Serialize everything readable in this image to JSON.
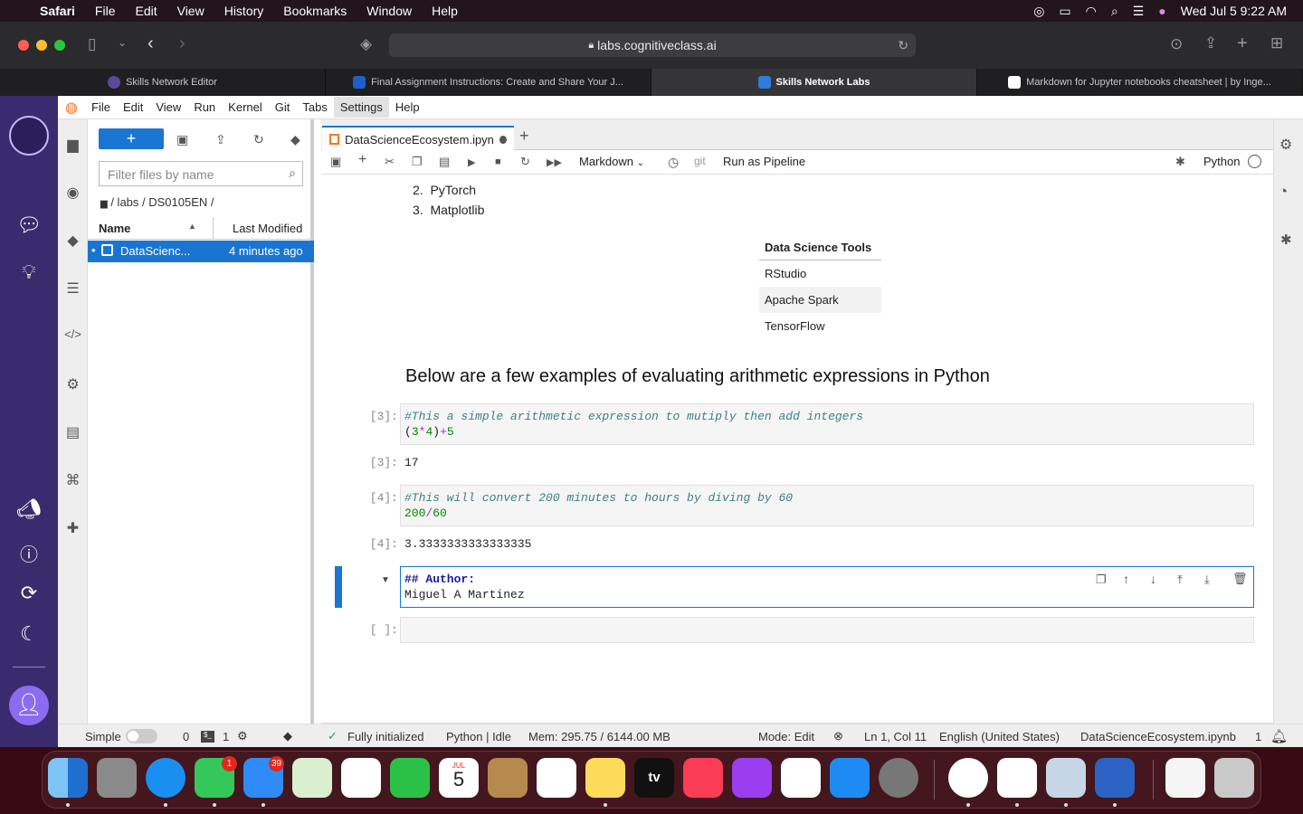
{
  "mac": {
    "apple": "",
    "app": "Safari",
    "menus": [
      "File",
      "Edit",
      "View",
      "History",
      "Bookmarks",
      "Window",
      "Help"
    ],
    "clock": "Wed Jul 5  9:22 AM"
  },
  "safari": {
    "url": "labs.cognitiveclass.ai",
    "tabs": [
      {
        "label": "Skills Network Editor",
        "active": false
      },
      {
        "label": "Final Assignment Instructions: Create and Share Your J...",
        "active": false
      },
      {
        "label": "Skills Network Labs",
        "active": true
      },
      {
        "label": "Markdown for Jupyter notebooks cheatsheet | by Inge...",
        "active": false
      }
    ]
  },
  "jupyter": {
    "menus": [
      "File",
      "Edit",
      "View",
      "Run",
      "Kernel",
      "Git",
      "Tabs",
      "Settings",
      "Help"
    ],
    "selected_menu": "Settings",
    "filter_placeholder": "Filter files by name",
    "breadcrumb": "/ labs / DS0105EN /",
    "file_header": {
      "name": "Name",
      "modified": "Last Modified"
    },
    "files": [
      {
        "name": "DataScienc...",
        "modified": "4 minutes ago"
      }
    ],
    "notebook_tab": "DataScienceEcosystem.ipyn",
    "cell_type": "Markdown",
    "git_label": "git",
    "pipeline": "Run as Pipeline",
    "kernel": "Python"
  },
  "notebook": {
    "list": [
      {
        "n": "2.",
        "t": "PyTorch"
      },
      {
        "n": "3.",
        "t": "Matplotlib"
      }
    ],
    "table": {
      "header": "Data Science Tools",
      "rows": [
        "RStudio",
        "Apache Spark",
        "TensorFlow"
      ]
    },
    "heading": "Below are a few examples of evaluating arithmetic expressions in Python",
    "cells": [
      {
        "prompt": "[3]:",
        "comment": "#This a simple arithmetic expression to mutiply then add integers",
        "out_prompt": "[3]:",
        "output": "17"
      },
      {
        "prompt": "[4]:",
        "comment": "#This will convert 200 minutes to hours by diving by 60",
        "out_prompt": "[4]:",
        "output": "3.3333333333333335"
      }
    ],
    "author_heading": "## Author:",
    "author_name": "Miguel A Martinez",
    "empty_prompt": "[ ]:"
  },
  "status": {
    "mode_label": "Simple",
    "terminals": "0",
    "kernels": "1",
    "git_state": "Fully initialized",
    "kernel_state": "Python | Idle",
    "memory": "Mem: 295.75 / 6144.00 MB",
    "edit_mode": "Mode: Edit",
    "cursor": "Ln 1, Col 11",
    "language": "English (United States)",
    "file": "DataScienceEcosystem.ipynb",
    "notifications": "1"
  },
  "dock": {
    "messages_badge": "1",
    "mail_badge": "39",
    "calendar_month": "JUL",
    "calendar_day": "5",
    "tv_label": "tv"
  }
}
